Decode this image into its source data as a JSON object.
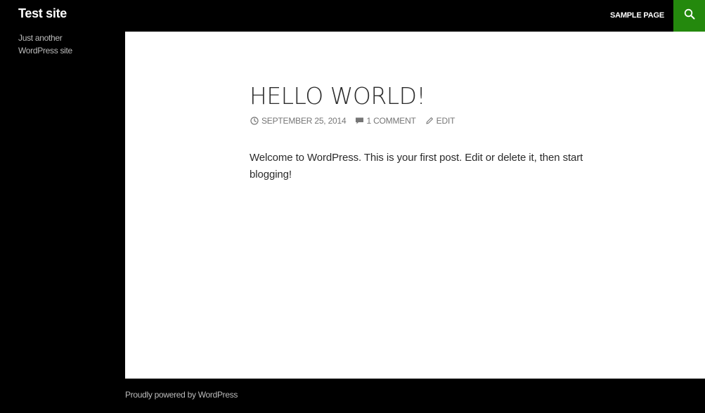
{
  "header": {
    "site_title": "Test site",
    "nav": [
      {
        "label": "SAMPLE PAGE"
      }
    ],
    "search_icon": "search-icon",
    "accent_color": "#24890d"
  },
  "sidebar": {
    "description": "Just another WordPress site"
  },
  "post": {
    "title": "HELLO WORLD!",
    "meta": {
      "date": "SEPTEMBER 25, 2014",
      "date_icon": "clock-icon",
      "comments": "1 COMMENT",
      "comments_icon": "comment-bubble-icon",
      "edit": "EDIT",
      "edit_icon": "pencil-icon"
    },
    "content": "Welcome to WordPress. This is your first post. Edit or delete it, then start blogging!"
  },
  "footer": {
    "credit": "Proudly powered by WordPress"
  },
  "colors": {
    "background": "#000000",
    "content_background": "#ffffff",
    "text": "#2b2b2b",
    "meta_text": "#767676",
    "sidebar_text": "#bbbbbb",
    "accent": "#24890d"
  }
}
